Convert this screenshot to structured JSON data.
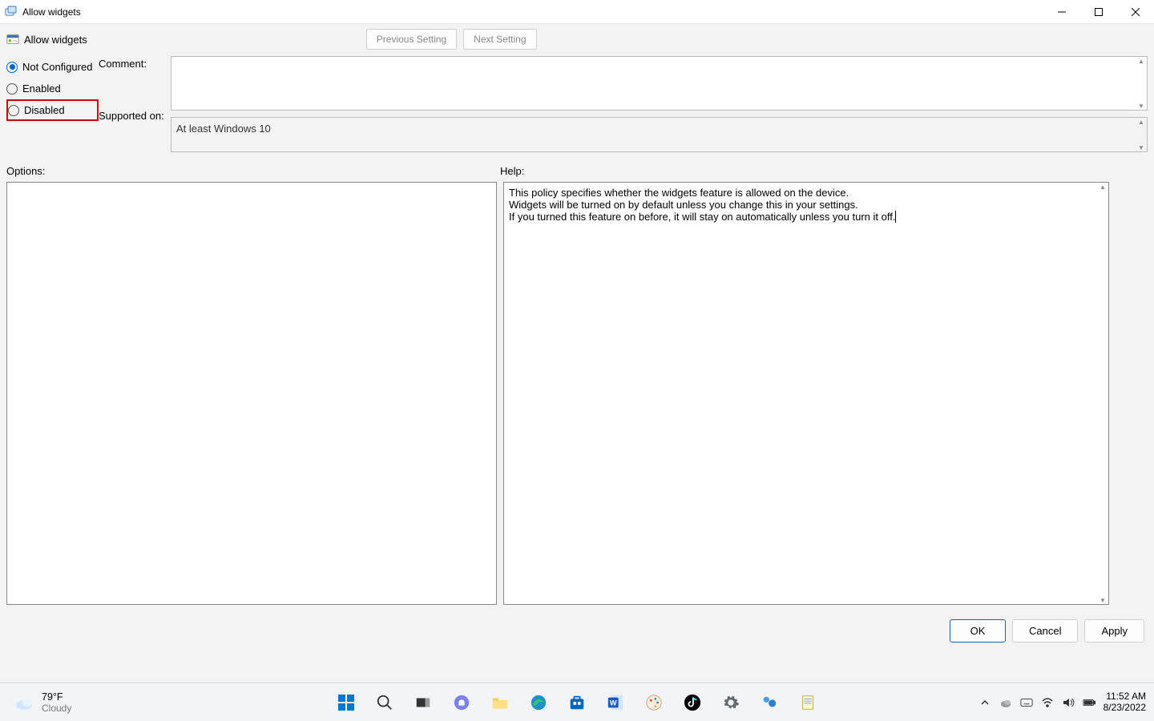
{
  "titlebar": {
    "title": "Allow widgets"
  },
  "toolbar": {
    "title": "Allow widgets",
    "prev_label": "Previous Setting",
    "next_label": "Next Setting"
  },
  "labels": {
    "comment": "Comment:",
    "supported": "Supported on:",
    "options": "Options:",
    "help": "Help:"
  },
  "radios": {
    "not_configured": "Not Configured",
    "enabled": "Enabled",
    "disabled": "Disabled",
    "selected": "not_configured",
    "highlighted": "disabled"
  },
  "fields": {
    "comment_value": "",
    "supported_value": "At least Windows 10"
  },
  "help_text": "This policy specifies whether the widgets feature is allowed on the device.\nWidgets will be turned on by default unless you change this in your settings.\nIf you turned this feature on before, it will stay on automatically unless you turn it off.",
  "buttons": {
    "ok": "OK",
    "cancel": "Cancel",
    "apply": "Apply"
  },
  "taskbar": {
    "weather_temp": "79°F",
    "weather_cond": "Cloudy",
    "time": "11:52 AM",
    "date": "8/23/2022"
  }
}
